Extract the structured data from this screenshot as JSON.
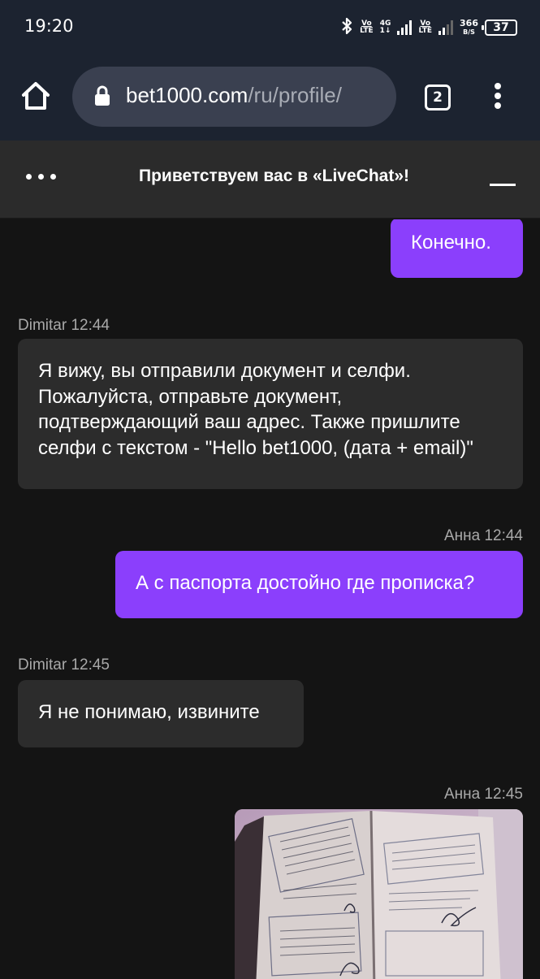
{
  "status_bar": {
    "time": "19:20",
    "sim1_top": "Vo",
    "sim1_bottom": "LTE",
    "net_top": "4G",
    "net_bottom": "1↓",
    "sim2_top": "Vo",
    "sim2_bottom": "LTE",
    "speed_top": "366",
    "speed_bottom": "B/S",
    "battery": "37"
  },
  "browser": {
    "url_host": "bet1000.com",
    "url_path": "/ru/profile/",
    "tab_count": "2"
  },
  "chat_header": {
    "title": "Приветствуем вас в «LiveChat»!"
  },
  "messages": [
    {
      "direction": "out",
      "sender": "",
      "time": "",
      "text": "Конечно."
    },
    {
      "direction": "in",
      "sender": "Dimitar",
      "time": "12:44",
      "text": "Я вижу, вы отправили документ и селфи. Пожалуйста, отправьте документ, подтверждающий ваш адрес. Также пришлите селфи с текстом - \"Hello bet1000, (дата + email)\""
    },
    {
      "direction": "out",
      "sender": "Анна",
      "time": "12:44",
      "text": "А с паспорта достойно где прописка?"
    },
    {
      "direction": "in",
      "sender": "Dimitar",
      "time": "12:45",
      "text": "Я не понимаю, извините"
    },
    {
      "direction": "out",
      "sender": "Анна",
      "time": "12:45",
      "text": ""
    }
  ],
  "labels": {
    "m1_meta": "Dimitar 12:44",
    "m2_meta": "Анна 12:44",
    "m3_meta": "Dimitar 12:45",
    "m4_meta": "Анна 12:45"
  },
  "colors": {
    "accent": "#8b3ffc",
    "incoming_bubble": "#2c2c2c",
    "background": "#141414",
    "header": "#2b2b2b",
    "browser_bar": "#1c2330"
  }
}
